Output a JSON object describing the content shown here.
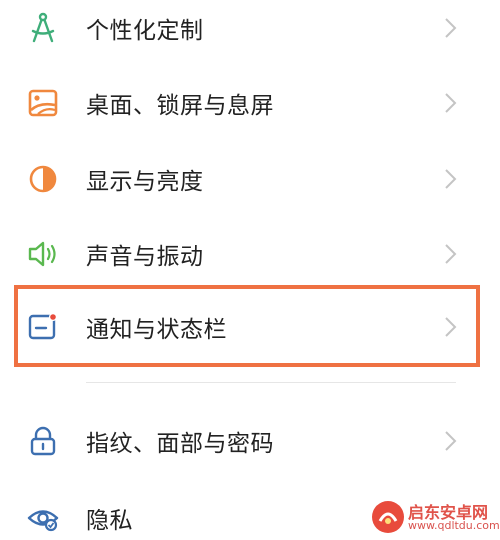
{
  "colors": {
    "highlight": "#ef7142",
    "icon_green": "#3fae7a",
    "icon_orange": "#f0883e",
    "icon_blue": "#3d6fb0",
    "icon_sound_green": "#5ab84f",
    "text": "#222222",
    "chevron": "#c4c4c4"
  },
  "settings": {
    "items": [
      {
        "label": "个性化定制",
        "icon": "compass-drafting-icon"
      },
      {
        "label": "桌面、锁屏与息屏",
        "icon": "wallpaper-icon"
      },
      {
        "label": "显示与亮度",
        "icon": "brightness-icon"
      },
      {
        "label": "声音与振动",
        "icon": "speaker-icon"
      },
      {
        "label": "通知与状态栏",
        "icon": "notification-icon",
        "highlighted": true
      },
      {
        "label": "指纹、面部与密码",
        "icon": "lock-icon"
      },
      {
        "label": "隐私",
        "icon": "privacy-eye-icon"
      }
    ]
  },
  "watermark": {
    "name": "启东安卓网",
    "url": "www.qdltdu.com"
  }
}
